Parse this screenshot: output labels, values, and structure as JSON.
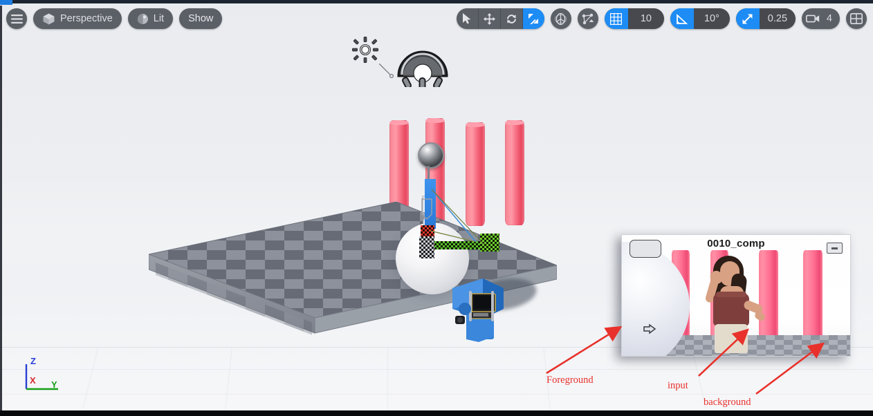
{
  "viewport": {
    "toolbar_left": {
      "menu_icon": "hamburger-menu-icon",
      "perspective_label": "Perspective",
      "perspective_icon": "cube-icon",
      "lighting_label": "Lit",
      "lighting_icon": "sphere-shading-icon",
      "show_label": "Show"
    },
    "toolbar_right": {
      "transform_modes": [
        {
          "name": "select",
          "icon": "cursor-arrow-icon",
          "active": false
        },
        {
          "name": "translate",
          "icon": "move-arrows-icon",
          "active": false
        },
        {
          "name": "rotate",
          "icon": "rotate-arrows-icon",
          "active": false
        },
        {
          "name": "scale",
          "icon": "scale-arrows-icon",
          "active": true
        }
      ],
      "coordinate_system_icon": "world-axis-globe-icon",
      "surface_snap_icon": "surface-snapping-icon",
      "grid_snap": {
        "icon": "grid-icon",
        "value": "10",
        "active": true
      },
      "angle_snap": {
        "icon": "angle-icon",
        "value": "10°",
        "active": true
      },
      "scale_snap": {
        "icon": "scale-snap-arrow-icon",
        "value": "0.25",
        "active": true
      },
      "camera_speed": {
        "icon": "camera-icon",
        "value": "4"
      },
      "layout_icon": "viewport-layout-icon"
    },
    "axis_widget": {
      "z": "Z",
      "x": "X",
      "y": "Y",
      "z_color": "#2b3fd6",
      "x_color": "#d62b2b",
      "y_color": "#16a016"
    }
  },
  "scene": {
    "pillar_color": "#ff8a99",
    "floor_color_a": "#6d727d",
    "floor_color_b": "#898e99",
    "lights": [
      {
        "name": "directional-light-icon"
      },
      {
        "name": "sky-light-icon"
      }
    ],
    "objects": [
      {
        "name": "chrome-ball"
      },
      {
        "name": "white-sphere"
      },
      {
        "name": "cine-camera"
      },
      {
        "name": "checker-stage"
      }
    ],
    "gizmo": {
      "name": "translate-gizmo",
      "x_color": "#e03b2f",
      "y_color": "#5bbf2a",
      "z_color": "#2a7fe0"
    }
  },
  "pip": {
    "title": "0010_comp",
    "minimize_icon": "minimize-icon",
    "toggle_button": "pip-toggle-button",
    "cursor_icon": "hand-cursor-icon"
  },
  "annotations": [
    {
      "text": "Foreground",
      "color": "#e8312b"
    },
    {
      "text": "input",
      "color": "#e8312b"
    },
    {
      "text": "background",
      "color": "#e8312b"
    }
  ]
}
